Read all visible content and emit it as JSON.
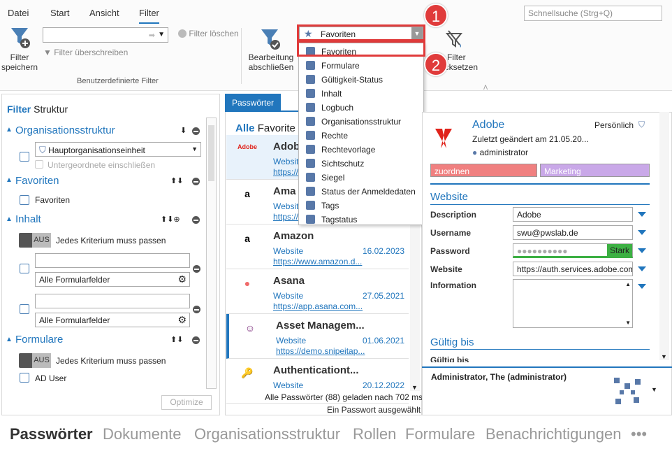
{
  "menu": {
    "file": "Datei",
    "start": "Start",
    "view": "Ansicht",
    "filter": "Filter"
  },
  "search": {
    "placeholder": "Schnellsuche (Strg+Q)"
  },
  "ribbon": {
    "save_filter": "Filter\nspeichern",
    "clear_filter": "Filter löschen",
    "overwrite_filter": "Filter überschreiben",
    "group_label": "Benutzerdefinierte Filter",
    "finish_edit": "Bearbeitung\nabschließen",
    "reset_filter_a": "Filter",
    "reset_filter_b": "ücksetzen",
    "combo_value": "Favoriten"
  },
  "dropdown": {
    "items": [
      "Favoriten",
      "Formulare",
      "Gültigkeit-Status",
      "Inhalt",
      "Logbuch",
      "Organisationsstruktur",
      "Rechte",
      "Rechtevorlage",
      "Sichtschutz",
      "Siegel",
      "Status der Anmeldedaten",
      "Tags",
      "Tagstatus"
    ],
    "icons": [
      "star-icon",
      "form-icon",
      "validity-icon",
      "content-icon",
      "logbook-icon",
      "org-structure-icon",
      "rights-icon",
      "rights-template-icon",
      "privacy-icon",
      "seal-icon",
      "credential-status-icon",
      "tag-icon",
      "tag-status-icon"
    ]
  },
  "badges": {
    "one": "1",
    "two": "2"
  },
  "filterpanel": {
    "tab_filter": "Filter",
    "tab_structure": "Struktur",
    "org_title": "Organisationsstruktur",
    "org_value": "Hauptorganisationseinheit",
    "org_sub": "Untergeordnete einschließen",
    "fav_title": "Favoriten",
    "fav_item": "Favoriten",
    "content_title": "Inhalt",
    "toggle_off": "AUS",
    "all_criteria": "Jedes Kriterium muss passen",
    "all_fields": "Alle Formularfelder",
    "forms_title": "Formulare",
    "ad_user": "AD User",
    "optimize": "Optimize"
  },
  "list": {
    "tab": "Passwörter",
    "header_all": "Alle",
    "header_fav": "Favorite",
    "rows": [
      {
        "title": "Adob",
        "website": "Website",
        "url": "https://",
        "date": "",
        "logo": "Adobe"
      },
      {
        "title": "Ama",
        "website": "Website",
        "url": "https://",
        "date": "",
        "logo": "a"
      },
      {
        "title": "Amazon",
        "website": "Website",
        "url": "https://www.amazon.d...",
        "date": "16.02.2023",
        "logo": "a"
      },
      {
        "title": "Asana",
        "website": "Website",
        "url": "https://app.asana.com...",
        "date": "27.05.2021",
        "logo": "●"
      },
      {
        "title": "Asset Managem...",
        "website": "Website",
        "url": "https://demo.snipeitap...",
        "date": "01.06.2021",
        "logo": "☺"
      },
      {
        "title": "Authenticationt...",
        "website": "Website",
        "url": "",
        "date": "20.12.2022",
        "logo": "🔑"
      }
    ],
    "status1": "Alle Passwörter (88) geladen nach 702 ms",
    "status2": "Ein Passwort ausgewählt"
  },
  "detail": {
    "name": "Adobe",
    "personal": "Persönlich",
    "changed": "Zuletzt geändert am 21.05.20...",
    "user": "administrator",
    "tag_assign": "zuordnen",
    "tag_marketing": "Marketing",
    "section_website": "Website",
    "desc_label": "Description",
    "desc_value": "Adobe",
    "user_label": "Username",
    "user_value": "swu@pwslab.de",
    "pw_label": "Password",
    "pw_value": "●●●●●●●●●●",
    "pw_strength": "Stark",
    "site_label": "Website",
    "site_value": "https://auth.services.adobe.com",
    "info_label": "Information",
    "section_valid": "Gültig bis",
    "valid_label": "Gültig bis",
    "footer_user": "Administrator, The (administrator)"
  },
  "bottomnav": [
    "Passwörter",
    "Dokumente",
    "Organisationsstruktur",
    "Rollen",
    "Formulare",
    "Benachrichtigungen",
    "•••"
  ],
  "colors": {
    "accent": "#2176bd",
    "badge_red": "#e03b3b",
    "tag_red": "#f08080",
    "tag_purple": "#c9a8e8"
  }
}
